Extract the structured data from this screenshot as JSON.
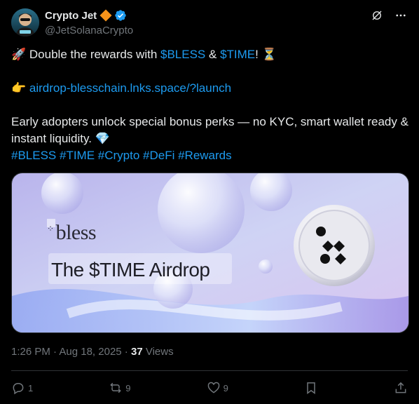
{
  "author": {
    "name": "Crypto Jet",
    "handle": "@JetSolanaCrypto"
  },
  "tweet": {
    "line1_pre": "Double the rewards with ",
    "cashtag1": "$BLESS",
    "line1_mid": " & ",
    "cashtag2": "$TIME",
    "line1_post": "!",
    "link": "airdrop-blesschain.lnks.space/?launch",
    "line3": "Early adopters unlock special bonus perks — no KYC, smart wallet ready & instant liquidity.",
    "hashtags": "#BLESS #TIME #Crypto #DeFi #Rewards"
  },
  "media": {
    "brand": "bless",
    "headline": "The $TIME Airdrop"
  },
  "meta": {
    "time": "1:26 PM",
    "sep1": " · ",
    "date": "Aug 18, 2025",
    "sep2": " · ",
    "views_count": "37",
    "views_label": " Views"
  },
  "actions": {
    "replies": "1",
    "reposts": "9",
    "likes": "9"
  },
  "colors": {
    "accent": "#1d9bf0",
    "background": "#000000",
    "text": "#e7e9ea",
    "muted": "#71767b"
  }
}
